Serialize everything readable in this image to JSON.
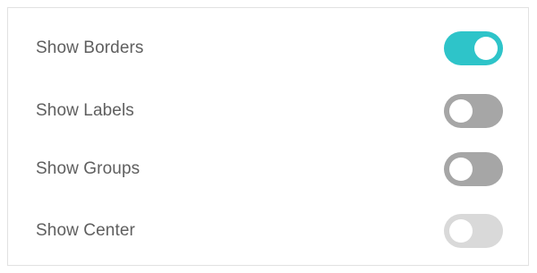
{
  "settings": {
    "items": [
      {
        "label": "Show Borders",
        "state": "on",
        "color": "#2ec4c9"
      },
      {
        "label": "Show Labels",
        "state": "off",
        "color": "#a6a6a6"
      },
      {
        "label": "Show Groups",
        "state": "off",
        "color": "#a6a6a6"
      },
      {
        "label": "Show Center",
        "state": "off-disabled",
        "color": "#d9d9d9"
      }
    ]
  }
}
